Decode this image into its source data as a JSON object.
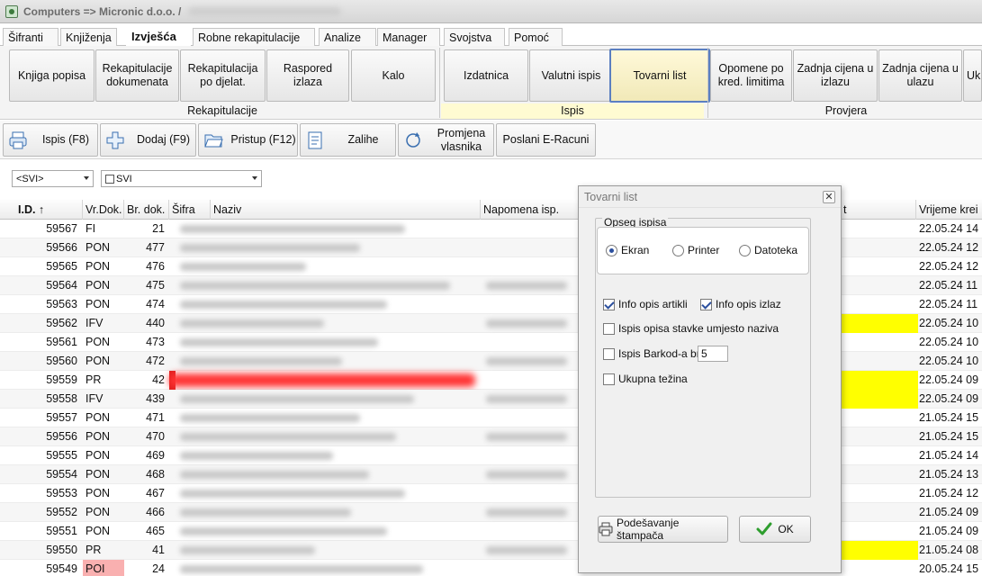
{
  "window": {
    "title": "Computers => Micronic d.o.o. /"
  },
  "menu": {
    "tabs": [
      "Šifranti",
      "Knjiženja",
      "Izvješća",
      "Robne rekapitulacije",
      "Analize",
      "Manager",
      "Svojstva",
      "Pomoć"
    ],
    "active": "Izvješća"
  },
  "ribbon": {
    "rekapitulacije": {
      "label": "Rekapitulacije",
      "buttons": [
        "Knjiga popisa",
        "Rekapitulacije dokumenata",
        "Rekapitulacija po djelat.",
        "Raspored izlaza",
        "Kalo"
      ]
    },
    "ispis": {
      "label": "Ispis",
      "buttons": [
        "Izdatnica",
        "Valutni ispis",
        "Tovarni list"
      ]
    },
    "provjera": {
      "label": "Provjera",
      "buttons": [
        "Opomene po kred. limitima",
        "Zadnja cijena u izlazu",
        "Zadnja cijena u ulazu",
        "Uk"
      ]
    }
  },
  "toolbar": {
    "buttons": [
      {
        "label": "Ispis (F8)",
        "icon": "printer-icon"
      },
      {
        "label": "Dodaj (F9)",
        "icon": "plus-icon"
      },
      {
        "label": "Pristup (F12)",
        "icon": "folder-icon"
      },
      {
        "label": "Zalihe",
        "icon": "document-icon"
      },
      {
        "label": "Promjena vlasnika",
        "icon": "refresh-icon"
      },
      {
        "label": "Poslani E-Racuni",
        "icon": ""
      }
    ]
  },
  "filters": {
    "doc_type": "<SVI>",
    "status": "SVI"
  },
  "grid": {
    "columns": [
      "I.D. ↑",
      "Vr.Dok.",
      "Br. dok.",
      "Šifra",
      "Naziv",
      "Napomena isp.",
      "t",
      "Vrijeme krei"
    ],
    "rows": [
      {
        "id": "59567",
        "type": "FI",
        "num": "21",
        "time": "22.05.24 14"
      },
      {
        "id": "59566",
        "type": "PON",
        "num": "477",
        "time": "22.05.24 12"
      },
      {
        "id": "59565",
        "type": "PON",
        "num": "476",
        "time": "22.05.24 12"
      },
      {
        "id": "59564",
        "type": "PON",
        "num": "475",
        "time": "22.05.24 11"
      },
      {
        "id": "59563",
        "type": "PON",
        "num": "474",
        "time": "22.05.24 11"
      },
      {
        "id": "59562",
        "type": "IFV",
        "num": "440",
        "time": "22.05.24 10"
      },
      {
        "id": "59561",
        "type": "PON",
        "num": "473",
        "time": "22.05.24 10"
      },
      {
        "id": "59560",
        "type": "PON",
        "num": "472",
        "time": "22.05.24 10"
      },
      {
        "id": "59559",
        "type": "PR",
        "num": "42",
        "time": "22.05.24 09"
      },
      {
        "id": "59558",
        "type": "IFV",
        "num": "439",
        "time": "22.05.24 09"
      },
      {
        "id": "59557",
        "type": "PON",
        "num": "471",
        "time": "21.05.24 15"
      },
      {
        "id": "59556",
        "type": "PON",
        "num": "470",
        "time": "21.05.24 15"
      },
      {
        "id": "59555",
        "type": "PON",
        "num": "469",
        "time": "21.05.24 14"
      },
      {
        "id": "59554",
        "type": "PON",
        "num": "468",
        "time": "21.05.24 13"
      },
      {
        "id": "59553",
        "type": "PON",
        "num": "467",
        "time": "21.05.24 12"
      },
      {
        "id": "59552",
        "type": "PON",
        "num": "466",
        "time": "21.05.24 09"
      },
      {
        "id": "59551",
        "type": "PON",
        "num": "465",
        "time": "21.05.24 09"
      },
      {
        "id": "59550",
        "type": "PR",
        "num": "41",
        "time": "21.05.24 08"
      },
      {
        "id": "59549",
        "type": "POI",
        "num": "24",
        "time": "20.05.24 15"
      }
    ]
  },
  "dialog": {
    "title": "Tovarni list",
    "scope_label": "Opseg ispisa",
    "radios": [
      "Ekran",
      "Printer",
      "Datoteka"
    ],
    "selected_radio": "Ekran",
    "checks": [
      {
        "label": "Info opis artikli",
        "checked": true
      },
      {
        "label": "Info opis izlaz",
        "checked": true
      },
      {
        "label": "Ispis opisa stavke umjesto naziva",
        "checked": false
      },
      {
        "label": "Ispis Barkod-a br. :",
        "checked": false
      },
      {
        "label": "Ukupna težina",
        "checked": false
      }
    ],
    "barcode_count": "5",
    "printer_setup_label": "Podešavanje štampača",
    "ok_label": "OK"
  },
  "colors": {
    "highlight_yellow": "#ffff00",
    "selected_border": "#5b7fc0",
    "poi_bg": "#f9b0b0",
    "ok_check": "#2e9e2e"
  }
}
